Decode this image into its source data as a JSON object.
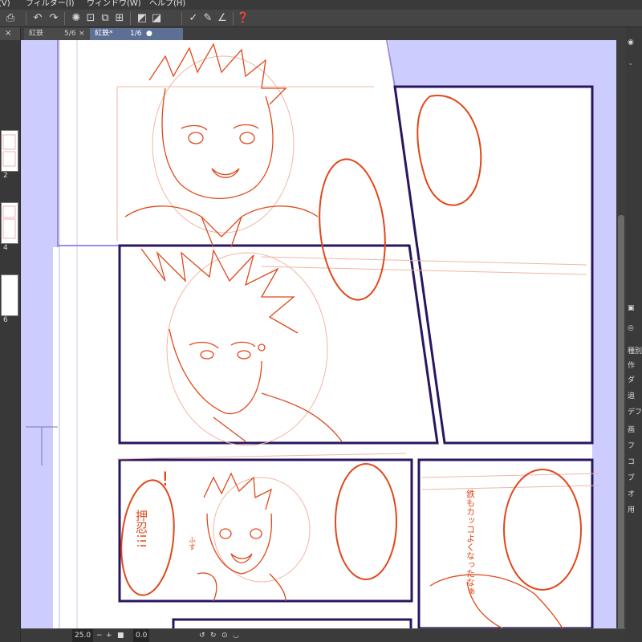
{
  "menu": {
    "items": [
      "(V)",
      "フィルター(I)",
      "ウィンドウ(W)",
      "ヘルプ(H)"
    ]
  },
  "toolbar": {
    "icons": [
      "print-icon",
      "undo-icon",
      "redo-icon",
      "spinner-icon",
      "clear-icon",
      "transform-icon",
      "hide-selection-icon",
      "select-all-icon",
      "pen-correct-icon",
      "brush-correct-icon",
      "ruler-snap-icon",
      "help-icon"
    ]
  },
  "left_panel": {
    "close_glyph": "×",
    "page_numbers": [
      "2",
      "4",
      "6"
    ]
  },
  "tabs": [
    {
      "label": "紅鉄",
      "pages": "5/6",
      "close": "×"
    },
    {
      "label": "紅鉄*",
      "pages": "1/6",
      "close": "●"
    }
  ],
  "status": {
    "zoom": "25.0",
    "angle": "0.0",
    "minus": "−",
    "plus": "+"
  },
  "right_panel": {
    "labels": [
      "種別",
      "作",
      "ダ",
      "追",
      "デフォ",
      "画",
      "フ",
      "コ",
      "ブ",
      "オ",
      "用"
    ]
  },
  "manga": {
    "sfx": [
      "押忍!!!",
      "ふす"
    ],
    "note": "鉄もカッコよくなったなぁ",
    "exclaim": "!"
  },
  "colors": {
    "canvas_bg": "#ccccff",
    "frame_line": "#2a1660",
    "sketch": "#e0481a",
    "sketch_light": "#f0b6a3",
    "active_tab": "#5e6f96"
  }
}
